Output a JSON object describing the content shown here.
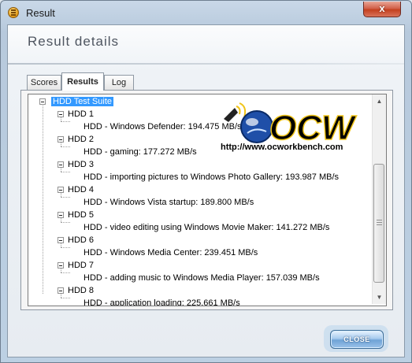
{
  "window": {
    "title": "Result",
    "close_glyph": "x"
  },
  "header": {
    "title": "Result details"
  },
  "tabs": [
    {
      "label": "Scores",
      "active": false
    },
    {
      "label": "Results",
      "active": true
    },
    {
      "label": "Log",
      "active": false
    }
  ],
  "tree": {
    "root": "HDD Test Suite",
    "groups": [
      {
        "label": "HDD 1",
        "item": "HDD - Windows Defender: 194.475 MB/s"
      },
      {
        "label": "HDD 2",
        "item": "HDD - gaming: 177.272 MB/s"
      },
      {
        "label": "HDD 3",
        "item": "HDD - importing pictures to Windows Photo Gallery: 193.987 MB/s"
      },
      {
        "label": "HDD 4",
        "item": "HDD - Windows Vista startup: 189.800 MB/s"
      },
      {
        "label": "HDD 5",
        "item": "HDD - video editing using Windows Movie Maker: 141.272 MB/s"
      },
      {
        "label": "HDD 6",
        "item": "HDD - Windows Media Center: 239.451 MB/s"
      },
      {
        "label": "HDD 7",
        "item": "HDD - adding music to Windows Media Player: 157.039 MB/s"
      },
      {
        "label": "HDD 8",
        "item": "HDD - application loading: 225.661 MB/s"
      }
    ]
  },
  "watermark": {
    "logo_text": "OCW",
    "url": "http://www.ocworkbench.com"
  },
  "footer": {
    "close_label": "CLOSE"
  },
  "colors": {
    "selection": "#3399ff",
    "logo_gold": "#f0c419",
    "logo_black": "#000000",
    "close_red": "#c4401f",
    "button_blue": "#6fa3d6"
  },
  "icons": {
    "app": "pm-logo-icon",
    "titlebar_close": "close-icon",
    "scroll_up": "up-arrow-icon",
    "scroll_down": "down-arrow-icon",
    "logo": "ocw-globe-icon"
  }
}
